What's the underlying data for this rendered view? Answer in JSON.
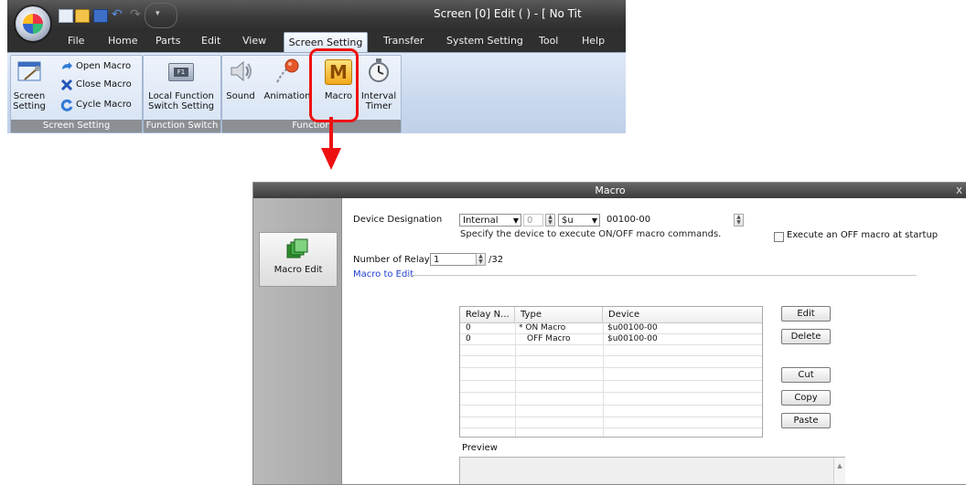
{
  "ribbon_window": {
    "title": "Screen [0] Edit (          ) - [ No Tit",
    "tabs": [
      "File",
      "Home",
      "Parts",
      "Edit",
      "View",
      "Screen Setting",
      "Transfer",
      "System Setting",
      "Tool",
      "Help"
    ],
    "active_tab": "Screen Setting",
    "groups": {
      "screen_setting": {
        "label": "Screen Setting",
        "screen_setting_button": [
          "Screen",
          "Setting"
        ],
        "open_macro": "Open Macro",
        "close_macro": "Close Macro",
        "cycle_macro": "Cycle Macro"
      },
      "function_switch": {
        "label": "Function Switch",
        "local_function": [
          "Local Function",
          "Switch Setting"
        ],
        "f1_text": "F1"
      },
      "function": {
        "label": "Function",
        "sound": "Sound",
        "animation": "Animation",
        "macro": "Macro",
        "macro_letter": "M",
        "interval_timer": [
          "Interval",
          "Timer"
        ]
      }
    }
  },
  "dialog": {
    "title": "Macro",
    "close_glyph": "x",
    "sidebar_item": "Macro Edit",
    "device_designation_label": "Device Designation",
    "device_type": "Internal",
    "station_value": "0",
    "device_prefix": "$u",
    "device_address": "00100-00",
    "device_hint": "Specify the device to execute ON/OFF macro commands.",
    "off_macro_checkbox_label": "Execute an OFF macro at startup",
    "off_macro_checked": false,
    "relays_label": "Number of Relays",
    "relays_value": "1",
    "relays_max": "/32",
    "macro_to_edit_label": "Macro to Edit",
    "table": {
      "columns": [
        "Relay N...",
        "Type",
        "Device"
      ],
      "rows": [
        {
          "relay": "0",
          "type": "* ON Macro",
          "device": "$u00100-00"
        },
        {
          "relay": "0",
          "type": "OFF Macro",
          "device": "$u00100-00"
        }
      ]
    },
    "buttons": {
      "edit": "Edit",
      "delete": "Delete",
      "cut": "Cut",
      "copy": "Copy",
      "paste": "Paste"
    },
    "preview_label": "Preview"
  },
  "colors": {
    "highlight": "#e11111",
    "group_label_bg": "#8c8f94",
    "section_label": "#1f3fd0"
  },
  "icons": [
    "app-orb-icon",
    "new-file-icon",
    "open-folder-icon",
    "save-icon",
    "undo-icon",
    "redo-icon",
    "screen-setting-icon",
    "open-macro-icon",
    "close-macro-icon",
    "cycle-macro-icon",
    "function-switch-icon",
    "sound-icon",
    "animation-icon",
    "macro-icon",
    "interval-timer-icon",
    "macro-edit-icon"
  ]
}
